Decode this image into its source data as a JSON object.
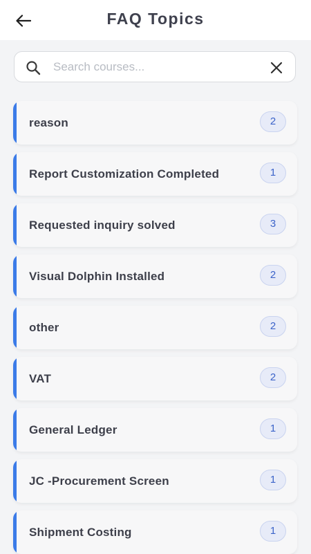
{
  "header": {
    "title": "FAQ Topics",
    "back_icon": "arrow-left-icon"
  },
  "search": {
    "placeholder": "Search courses...",
    "value": "",
    "search_icon": "search-icon",
    "clear_icon": "close-icon"
  },
  "colors": {
    "accent": "#3b7be8",
    "badge_bg": "#e7ebf8",
    "badge_text": "#3b63c9"
  },
  "topics": [
    {
      "label": "reason",
      "count": "2"
    },
    {
      "label": "Report Customization Completed",
      "count": "1"
    },
    {
      "label": "Requested inquiry solved",
      "count": "3"
    },
    {
      "label": "Visual Dolphin Installed",
      "count": "2"
    },
    {
      "label": "other",
      "count": "2"
    },
    {
      "label": "VAT",
      "count": "2"
    },
    {
      "label": "General Ledger",
      "count": "1"
    },
    {
      "label": "JC -Procurement Screen",
      "count": "1"
    },
    {
      "label": "Shipment Costing",
      "count": "1"
    }
  ]
}
